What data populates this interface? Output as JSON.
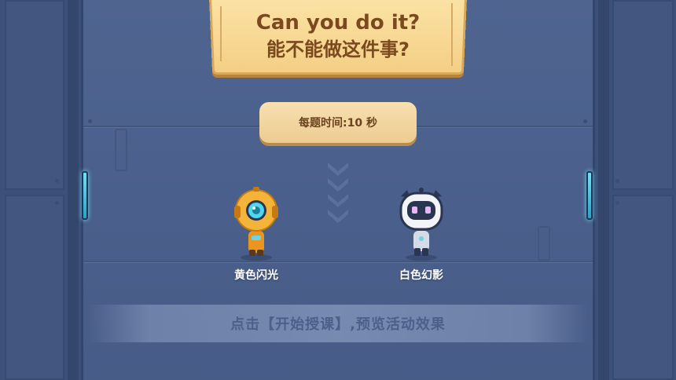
{
  "title": {
    "line1": "Can you do it?",
    "line2": "能不能做这件事?"
  },
  "timer": {
    "label": "每题时间:10 秒"
  },
  "characters": [
    {
      "name": "黄色闪光",
      "color": "#f0a92a",
      "icon": "yellow-robot"
    },
    {
      "name": "白色幻影",
      "color": "#f2f4f8",
      "icon": "white-robot"
    }
  ],
  "hint": {
    "text": "点击【开始授课】,预览活动效果"
  },
  "colors": {
    "background": "#4a5f89",
    "sign": "#f4cf85",
    "accent_light": "#6fe3f5"
  }
}
